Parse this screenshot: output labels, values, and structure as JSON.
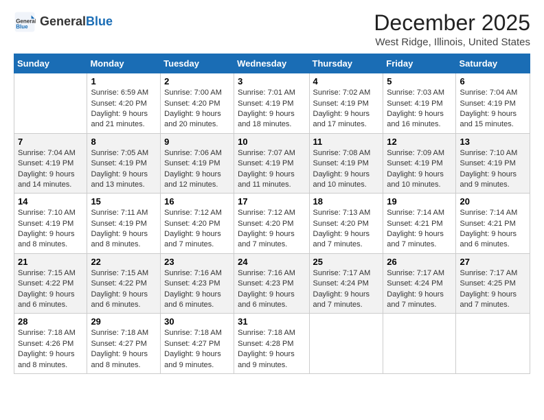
{
  "logo": {
    "general": "General",
    "blue": "Blue"
  },
  "header": {
    "title": "December 2025",
    "subtitle": "West Ridge, Illinois, United States"
  },
  "columns": [
    "Sunday",
    "Monday",
    "Tuesday",
    "Wednesday",
    "Thursday",
    "Friday",
    "Saturday"
  ],
  "weeks": [
    [
      {
        "day": "",
        "info": ""
      },
      {
        "day": "1",
        "info": "Sunrise: 6:59 AM\nSunset: 4:20 PM\nDaylight: 9 hours\nand 21 minutes."
      },
      {
        "day": "2",
        "info": "Sunrise: 7:00 AM\nSunset: 4:20 PM\nDaylight: 9 hours\nand 20 minutes."
      },
      {
        "day": "3",
        "info": "Sunrise: 7:01 AM\nSunset: 4:19 PM\nDaylight: 9 hours\nand 18 minutes."
      },
      {
        "day": "4",
        "info": "Sunrise: 7:02 AM\nSunset: 4:19 PM\nDaylight: 9 hours\nand 17 minutes."
      },
      {
        "day": "5",
        "info": "Sunrise: 7:03 AM\nSunset: 4:19 PM\nDaylight: 9 hours\nand 16 minutes."
      },
      {
        "day": "6",
        "info": "Sunrise: 7:04 AM\nSunset: 4:19 PM\nDaylight: 9 hours\nand 15 minutes."
      }
    ],
    [
      {
        "day": "7",
        "info": "Sunrise: 7:04 AM\nSunset: 4:19 PM\nDaylight: 9 hours\nand 14 minutes."
      },
      {
        "day": "8",
        "info": "Sunrise: 7:05 AM\nSunset: 4:19 PM\nDaylight: 9 hours\nand 13 minutes."
      },
      {
        "day": "9",
        "info": "Sunrise: 7:06 AM\nSunset: 4:19 PM\nDaylight: 9 hours\nand 12 minutes."
      },
      {
        "day": "10",
        "info": "Sunrise: 7:07 AM\nSunset: 4:19 PM\nDaylight: 9 hours\nand 11 minutes."
      },
      {
        "day": "11",
        "info": "Sunrise: 7:08 AM\nSunset: 4:19 PM\nDaylight: 9 hours\nand 10 minutes."
      },
      {
        "day": "12",
        "info": "Sunrise: 7:09 AM\nSunset: 4:19 PM\nDaylight: 9 hours\nand 10 minutes."
      },
      {
        "day": "13",
        "info": "Sunrise: 7:10 AM\nSunset: 4:19 PM\nDaylight: 9 hours\nand 9 minutes."
      }
    ],
    [
      {
        "day": "14",
        "info": "Sunrise: 7:10 AM\nSunset: 4:19 PM\nDaylight: 9 hours\nand 8 minutes."
      },
      {
        "day": "15",
        "info": "Sunrise: 7:11 AM\nSunset: 4:19 PM\nDaylight: 9 hours\nand 8 minutes."
      },
      {
        "day": "16",
        "info": "Sunrise: 7:12 AM\nSunset: 4:20 PM\nDaylight: 9 hours\nand 7 minutes."
      },
      {
        "day": "17",
        "info": "Sunrise: 7:12 AM\nSunset: 4:20 PM\nDaylight: 9 hours\nand 7 minutes."
      },
      {
        "day": "18",
        "info": "Sunrise: 7:13 AM\nSunset: 4:20 PM\nDaylight: 9 hours\nand 7 minutes."
      },
      {
        "day": "19",
        "info": "Sunrise: 7:14 AM\nSunset: 4:21 PM\nDaylight: 9 hours\nand 7 minutes."
      },
      {
        "day": "20",
        "info": "Sunrise: 7:14 AM\nSunset: 4:21 PM\nDaylight: 9 hours\nand 6 minutes."
      }
    ],
    [
      {
        "day": "21",
        "info": "Sunrise: 7:15 AM\nSunset: 4:22 PM\nDaylight: 9 hours\nand 6 minutes."
      },
      {
        "day": "22",
        "info": "Sunrise: 7:15 AM\nSunset: 4:22 PM\nDaylight: 9 hours\nand 6 minutes."
      },
      {
        "day": "23",
        "info": "Sunrise: 7:16 AM\nSunset: 4:23 PM\nDaylight: 9 hours\nand 6 minutes."
      },
      {
        "day": "24",
        "info": "Sunrise: 7:16 AM\nSunset: 4:23 PM\nDaylight: 9 hours\nand 6 minutes."
      },
      {
        "day": "25",
        "info": "Sunrise: 7:17 AM\nSunset: 4:24 PM\nDaylight: 9 hours\nand 7 minutes."
      },
      {
        "day": "26",
        "info": "Sunrise: 7:17 AM\nSunset: 4:24 PM\nDaylight: 9 hours\nand 7 minutes."
      },
      {
        "day": "27",
        "info": "Sunrise: 7:17 AM\nSunset: 4:25 PM\nDaylight: 9 hours\nand 7 minutes."
      }
    ],
    [
      {
        "day": "28",
        "info": "Sunrise: 7:18 AM\nSunset: 4:26 PM\nDaylight: 9 hours\nand 8 minutes."
      },
      {
        "day": "29",
        "info": "Sunrise: 7:18 AM\nSunset: 4:27 PM\nDaylight: 9 hours\nand 8 minutes."
      },
      {
        "day": "30",
        "info": "Sunrise: 7:18 AM\nSunset: 4:27 PM\nDaylight: 9 hours\nand 9 minutes."
      },
      {
        "day": "31",
        "info": "Sunrise: 7:18 AM\nSunset: 4:28 PM\nDaylight: 9 hours\nand 9 minutes."
      },
      {
        "day": "",
        "info": ""
      },
      {
        "day": "",
        "info": ""
      },
      {
        "day": "",
        "info": ""
      }
    ]
  ]
}
